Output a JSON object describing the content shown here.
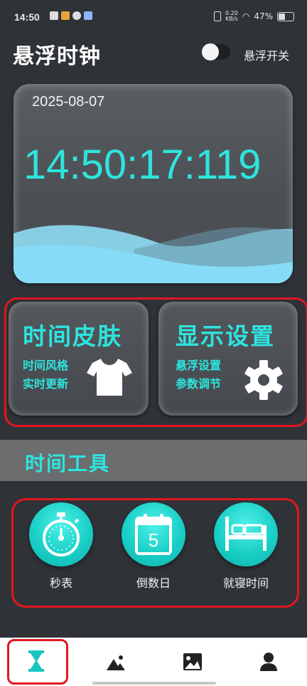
{
  "status_bar": {
    "time": "14:50",
    "net_speed_top": "0.20",
    "net_speed_bottom": "KB/s",
    "battery": "47%"
  },
  "header": {
    "title": "悬浮时钟",
    "toggle_label": "悬浮开关",
    "toggle_on": false
  },
  "clock_card": {
    "date": "2025-08-07",
    "time": "14:50:17:119"
  },
  "features": [
    {
      "title": "时间皮肤",
      "line1": "时间风格",
      "line2": "实时更新",
      "icon": "shirt-icon"
    },
    {
      "title": "显示设置",
      "line1": "悬浮设置",
      "line2": "参数调节",
      "icon": "gear-icon"
    }
  ],
  "section": {
    "title": "时间工具"
  },
  "tools": [
    {
      "label": "秒表",
      "icon": "stopwatch-icon"
    },
    {
      "label": "倒数日",
      "icon": "calendar-icon",
      "calendar_number": "5"
    },
    {
      "label": "就寝时间",
      "icon": "bed-icon"
    }
  ],
  "bottom_nav": [
    {
      "icon": "hourglass-icon",
      "selected": true
    },
    {
      "icon": "landscape-icon",
      "selected": false
    },
    {
      "icon": "picture-icon",
      "selected": false
    },
    {
      "icon": "person-icon",
      "selected": false
    }
  ],
  "colors": {
    "accent": "#2de5de",
    "background": "#2f3338",
    "highlight_frame": "#e0171f"
  }
}
